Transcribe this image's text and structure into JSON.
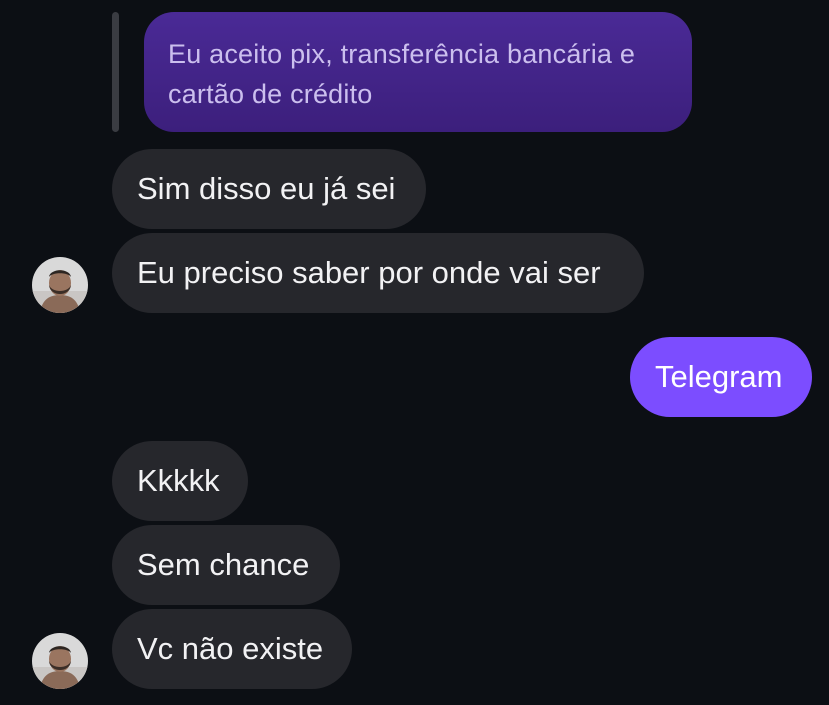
{
  "colors": {
    "background": "#0c0f14",
    "received_bubble": "#26272c",
    "sent_bubble": "#7c4dff",
    "quoted_bubble": "#3c1f7c"
  },
  "quoted_message": {
    "text": "Eu aceito pix, transferência bancária e cartão de crédito"
  },
  "messages": [
    {
      "direction": "received",
      "text": "Sim disso eu já sei"
    },
    {
      "direction": "received",
      "text": "Eu preciso saber por onde vai ser"
    },
    {
      "direction": "sent",
      "text": "Telegram"
    },
    {
      "direction": "received",
      "text": "Kkkkk"
    },
    {
      "direction": "received",
      "text": "Sem chance"
    },
    {
      "direction": "received",
      "text": "Vc não existe"
    }
  ]
}
